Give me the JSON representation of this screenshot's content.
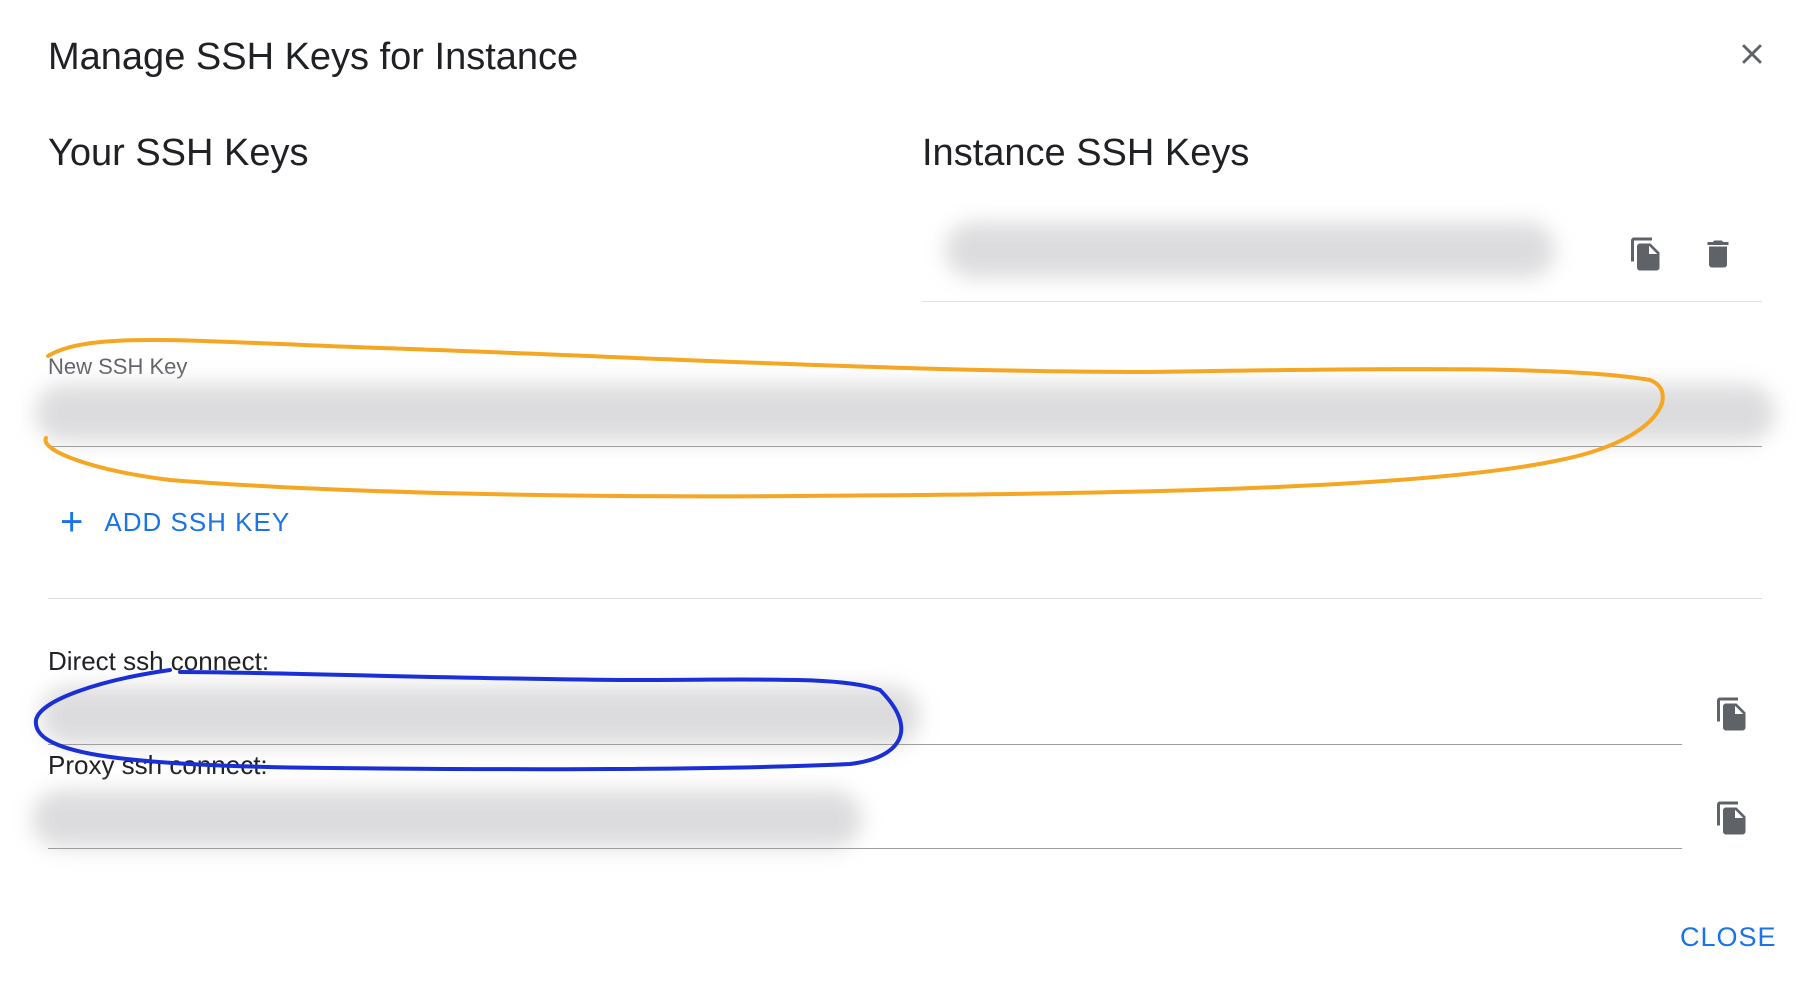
{
  "dialog": {
    "title": "Manage SSH Keys for Instance",
    "close_icon": "close-icon",
    "close_label": "CLOSE"
  },
  "your_keys": {
    "heading": "Your SSH Keys",
    "new_key_label": "New SSH Key",
    "new_key_value": "",
    "add_label": "ADD SSH KEY",
    "add_icon": "plus-icon"
  },
  "instance_keys": {
    "heading": "Instance SSH Keys",
    "items": [
      {
        "value": "",
        "copy_icon": "copy-icon",
        "delete_icon": "trash-icon"
      }
    ]
  },
  "connect": {
    "direct_label": "Direct ssh connect:",
    "direct_value": "",
    "proxy_label": "Proxy ssh connect:",
    "proxy_value": "",
    "copy_icon": "copy-icon"
  },
  "annotations": {
    "orange": "#f5a623",
    "blue": "#1a2fd6"
  },
  "colors": {
    "accent": "#1a73e8",
    "icon": "#5f6368"
  }
}
